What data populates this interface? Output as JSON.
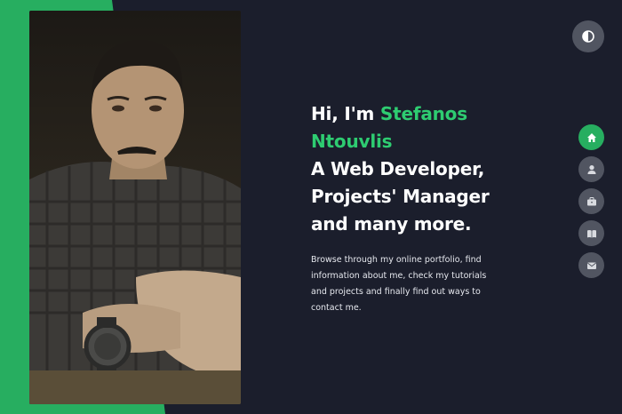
{
  "hero": {
    "greeting": "Hi, I'm ",
    "name_line1": "Stefanos",
    "name_line2": "Ntouvlis",
    "roles": [
      "A Web Developer,",
      "Projects' Manager",
      "and many more."
    ],
    "intro": "Browse through my online portfolio, find information about me, check my tutorials and projects and finally find out ways to contact me."
  },
  "theme_toggle": {
    "icon": "contrast-icon"
  },
  "nav": {
    "items": [
      {
        "icon": "home-icon",
        "active": true
      },
      {
        "icon": "user-icon",
        "active": false
      },
      {
        "icon": "briefcase-icon",
        "active": false
      },
      {
        "icon": "book-icon",
        "active": false
      },
      {
        "icon": "envelope-icon",
        "active": false
      }
    ]
  },
  "colors": {
    "background": "#1b1e2c",
    "accent": "#27ae60",
    "nav_inactive": "#515561"
  }
}
